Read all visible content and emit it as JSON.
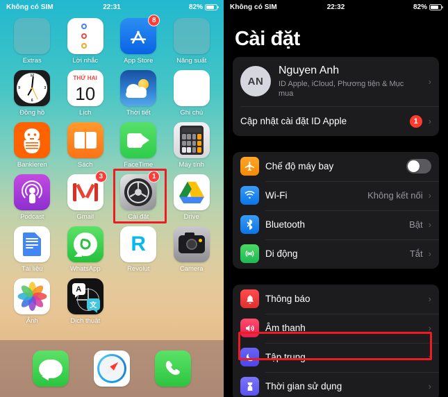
{
  "home": {
    "statusbar": {
      "carrier": "Không có SIM",
      "time": "22:31",
      "battery_pct": "82%"
    },
    "apps": [
      {
        "label": "Extras",
        "icon": "folder-icon",
        "badge": null
      },
      {
        "label": "Lời nhắc",
        "icon": "reminders-icon",
        "badge": null
      },
      {
        "label": "App Store",
        "icon": "app-store-icon",
        "badge": "8"
      },
      {
        "label": "Năng suất",
        "icon": "folder-icon",
        "badge": null
      },
      {
        "label": "Đồng hồ",
        "icon": "clock-icon",
        "badge": null
      },
      {
        "label": "Lịch",
        "icon": "calendar-icon",
        "badge": null,
        "cal_top": "THỨ HAI",
        "cal_day": "10"
      },
      {
        "label": "Thời tiết",
        "icon": "weather-icon",
        "badge": null
      },
      {
        "label": "Ghi chú",
        "icon": "notes-icon",
        "badge": null
      },
      {
        "label": "Bankieren",
        "icon": "bankieren-icon",
        "badge": null
      },
      {
        "label": "Sách",
        "icon": "books-icon",
        "badge": null
      },
      {
        "label": "FaceTime",
        "icon": "facetime-icon",
        "badge": null
      },
      {
        "label": "Máy tính",
        "icon": "calculator-icon",
        "badge": null
      },
      {
        "label": "Podcast",
        "icon": "podcast-icon",
        "badge": null
      },
      {
        "label": "Gmail",
        "icon": "gmail-icon",
        "badge": "3"
      },
      {
        "label": "Cài đặt",
        "icon": "settings-gear-icon",
        "badge": "1"
      },
      {
        "label": "Drive",
        "icon": "google-drive-icon",
        "badge": null
      },
      {
        "label": "Tài liệu",
        "icon": "google-docs-icon",
        "badge": null
      },
      {
        "label": "WhatsApp",
        "icon": "whatsapp-icon",
        "badge": null
      },
      {
        "label": "Revolut",
        "icon": "revolut-icon",
        "badge": null,
        "glyph": "R"
      },
      {
        "label": "Camera",
        "icon": "camera-icon",
        "badge": null
      },
      {
        "label": "Ảnh",
        "icon": "photos-icon",
        "badge": null
      },
      {
        "label": "Dịch thuật",
        "icon": "translate-icon",
        "badge": null,
        "glyph_a": "A",
        "glyph_b": "文"
      }
    ],
    "dock": [
      {
        "label": "Tin nhắn",
        "icon": "messages-icon"
      },
      {
        "label": "Safari",
        "icon": "safari-icon"
      },
      {
        "label": "Điện thoại",
        "icon": "phone-icon"
      }
    ],
    "highlight_color": "#ec1c24"
  },
  "settings": {
    "statusbar": {
      "carrier": "Không có SIM",
      "time": "22:32",
      "battery_pct": "82%"
    },
    "title": "Cài đặt",
    "account": {
      "initials": "AN",
      "name": "Nguyen Anh",
      "subtitle": "ID Apple, iCloud, Phương tiện & Mục mua",
      "update_row_label": "Cập nhật cài đặt ID Apple",
      "update_row_badge": "1"
    },
    "group_connectivity": [
      {
        "label": "Chế độ máy bay",
        "icon": "airplane-icon",
        "control": "toggle",
        "toggle_on": false,
        "value": ""
      },
      {
        "label": "Wi-Fi",
        "icon": "wifi-icon",
        "control": "value",
        "value": "Không kết nối"
      },
      {
        "label": "Bluetooth",
        "icon": "bluetooth-icon",
        "control": "value",
        "value": "Bật"
      },
      {
        "label": "Di động",
        "icon": "cellular-icon",
        "control": "value",
        "value": "Tắt"
      }
    ],
    "group_notifications": [
      {
        "label": "Thông báo",
        "icon": "notifications-bell-icon",
        "value": ""
      },
      {
        "label": "Âm thanh",
        "icon": "sounds-speaker-icon",
        "value": ""
      },
      {
        "label": "Tập trung",
        "icon": "focus-moon-icon",
        "value": "",
        "highlighted": true
      },
      {
        "label": "Thời gian sử dụng",
        "icon": "screen-time-hourglass-icon",
        "value": ""
      }
    ],
    "chevron": "›",
    "highlight_color": "#ec1c24"
  }
}
